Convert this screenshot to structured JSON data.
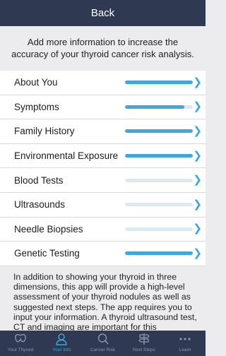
{
  "header": {
    "back_label": "Back"
  },
  "intro": {
    "text": "Add more information to increase the accuracy of your thyroid cancer risk analysis."
  },
  "sections": [
    {
      "label": "About You",
      "progress": 1.0
    },
    {
      "label": "Symptoms",
      "progress": 0.88
    },
    {
      "label": "Family History",
      "progress": 1.0
    },
    {
      "label": "Environmental Exposure",
      "progress": 1.0
    },
    {
      "label": "Blood Tests",
      "progress": 0.0
    },
    {
      "label": "Ultrasounds",
      "progress": 0.0
    },
    {
      "label": "Needle Biopsies",
      "progress": 0.0
    },
    {
      "label": "Genetic Testing",
      "progress": 1.0
    }
  ],
  "description": {
    "text": "In addition to showing your thyroid in three dimensions, this app will provide a high-level assessment of your thyroid nodules as well as suggested next steps. The app requires you to input your information. A thyroid ultrasound test, CT and imaging are important for this"
  },
  "tabs": [
    {
      "label": "Your Thyroid",
      "icon": "thyroid-icon",
      "active": false
    },
    {
      "label": "Your Info",
      "icon": "person-icon",
      "active": true
    },
    {
      "label": "Cancer Risk",
      "icon": "magnifier-icon",
      "active": false
    },
    {
      "label": "Next Steps",
      "icon": "signpost-icon",
      "active": false
    },
    {
      "label": "Learn",
      "icon": "more-dots-icon",
      "active": false
    }
  ],
  "colors": {
    "header_bg": "#2f3a52",
    "accent": "#3fa7dc",
    "track": "#dde9f1"
  }
}
